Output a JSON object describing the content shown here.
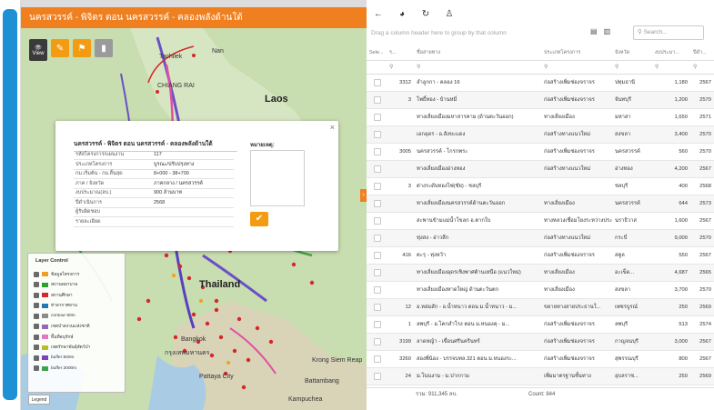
{
  "map": {
    "title": "นครสวรรค์ - พิจิตร ตอน นครสวรรค์ - คลองพลังด้านใต้",
    "tools": {
      "view_label": "View"
    },
    "labels": {
      "laos": "Laos",
      "thailand": "Thailand",
      "tachilek": "Tachilek",
      "nan": "Nan",
      "chiang_rai": "CHIANG RAI",
      "bangkok": "Bangkok",
      "krung_thep": "กรุงเทพมหานคร",
      "siem_reap": "Siem Reap",
      "krong_siem_reap": "Krong Siem Reap",
      "battambang": "Battambang",
      "cambodia": "Kampuchea",
      "pattaya": "Pattaya City"
    },
    "popup": {
      "title": "นครสวรรค์ - พิจิตร ตอน นครสวรรค์ - คลองพลังด้านใต้",
      "rows": [
        {
          "k": "รหัสโครงการ/แผนงาน",
          "v": "117"
        },
        {
          "k": "ประเภทโครงการ",
          "v": "บูรณะ/ปรับปรุงทาง"
        },
        {
          "k": "กม.เริ่มต้น - กม.สิ้นสุด",
          "v": "8+000 - 38+700"
        },
        {
          "k": "ภาค / จังหวัด",
          "v": "ภาคกลาง / นครสวรรค์"
        },
        {
          "k": "งบประมาณ(ลบ.)",
          "v": "900 ล้านบาท"
        },
        {
          "k": "ปีดำเนินการ",
          "v": "2568"
        },
        {
          "k": "ผู้รับผิดชอบ",
          "v": ""
        },
        {
          "k": "รายละเอียด",
          "v": ""
        }
      ],
      "note_label": "หมายเหตุ:",
      "ok_icon": "check-icon"
    },
    "layer_control": {
      "title": "Layer Control",
      "items": [
        {
          "label": "ข้อมูลโครงการ",
          "color": "#f0a020"
        },
        {
          "label": "สถานพยาบาล",
          "color": "#2ca02c"
        },
        {
          "label": "สถานศึกษา",
          "color": "#d62728"
        },
        {
          "label": "ท่าอากาศยาน",
          "color": "#1f77b4"
        },
        {
          "label": "contour 50m",
          "color": "#8c8c8c"
        },
        {
          "label": "เขตป่าสงวนแห่งชาติ",
          "color": "#9467bd"
        },
        {
          "label": "พื้นที่อนุรักษ์",
          "color": "#e377c2"
        },
        {
          "label": "เขตรักษาพันธุ์สัตว์ป่า",
          "color": "#bcbd22"
        },
        {
          "label": "buffer 500m",
          "color": "#7f3fbf"
        },
        {
          "label": "buffer 2000m",
          "color": "#3fa34d"
        }
      ]
    },
    "legend_label": "Legend"
  },
  "grid": {
    "group_hint": "Drag a column header here to group by that column",
    "search_placeholder": "Search...",
    "headers": [
      "Sele...",
      "ร...",
      "ชื่อสายทาง",
      "ประเภทโครงการ",
      "จังหวัด",
      "งบประมา...",
      "ปีดำ..."
    ],
    "filter_icon": "search-icon",
    "rows": [
      {
        "id": "3312",
        "name": "ลำลูกกา - คลอง 16",
        "type": "ก่อสร้างเพิ่มช่องจราจร",
        "prov": "ปทุมธานี",
        "budget": "1,180",
        "year": "2567"
      },
      {
        "id": "3",
        "name": "โพธิ์ทอง - บ้านหมี่",
        "type": "ก่อสร้างเพิ่มช่องจราจร",
        "prov": "จันทบุรี",
        "budget": "1,200",
        "year": "2570"
      },
      {
        "id": "",
        "name": "ทางเลี่ยงเมืองมหาสารคาม (ด้านตะวันออก)",
        "type": "ทางเลี่ยงเมือง",
        "prov": "มหาสา",
        "budget": "1,650",
        "year": "2571"
      },
      {
        "id": "",
        "name": "เอกอุดร - อ.สังขะแดง",
        "type": "ก่อสร้างทางแนวใหม่",
        "prov": "สงขลา",
        "budget": "3,400",
        "year": "2570"
      },
      {
        "id": "3005",
        "name": "นครสวรรค์ - โกรกพระ",
        "type": "ก่อสร้างเพิ่มช่องจราจร",
        "prov": "นครสวรรค์",
        "budget": "560",
        "year": "2570"
      },
      {
        "id": "",
        "name": "ทางเลี่ยงเมืองอ่างทอง",
        "type": "ก่อสร้างทางแนวใหม่",
        "prov": "อ่างทอง",
        "budget": "4,200",
        "year": "2567"
      },
      {
        "id": "3",
        "name": "ต่างระดับทองไฟ(ชัย) - ชลบุรี",
        "type": "",
        "prov": "ชลบุรี",
        "budget": "400",
        "year": "2568"
      },
      {
        "id": "",
        "name": "ทางเลี่ยงเมืองนครสวรรค์ด้านตะวันออก",
        "type": "ทางเลี่ยงเมือง",
        "prov": "นครสวรรค์",
        "budget": "644",
        "year": "2573"
      },
      {
        "id": "",
        "name": "สะพานข้ามแม่น้ำโขลก อ.ตากใบ",
        "type": "ทางหลวงเชื่อมโยงระหว่างประเทศ",
        "prov": "นราธิวาส",
        "budget": "1,600",
        "year": "2567"
      },
      {
        "id": "",
        "name": "ทุ่งสง - อ่าวลึก",
        "type": "ก่อสร้างทางแนวใหม่",
        "prov": "กระบี่",
        "budget": "9,000",
        "year": "2570"
      },
      {
        "id": "416",
        "name": "ตะรุ - ทุ่งหว้า",
        "type": "ก่อสร้างเพิ่มช่องจราจร",
        "prov": "สตูล",
        "budget": "550",
        "year": "2567"
      },
      {
        "id": "",
        "name": "ทางเลี่ยงเมืองอุดรเชิงพาศต้านเหนือ (แนวใหม่)",
        "type": "ทางเลี่ยงเมือง",
        "prov": "อะเข็ด...",
        "budget": "4,687",
        "year": "2565"
      },
      {
        "id": "",
        "name": "ทางเลี่ยงเมืองหาดใหญ่ ด้านตะวันตก",
        "type": "ทางเลี่ยงเมือง",
        "prov": "สงขลา",
        "budget": "3,700",
        "year": "2570"
      },
      {
        "id": "12",
        "name": "อ.หล่มสัก - อ.น้ำหนาว ตอน ม.น้ำหนาว - ม...",
        "type": "ขยายทางสายประธานใ...",
        "prov": "เพชรบูรณ์",
        "budget": "250",
        "year": "2569"
      },
      {
        "id": "1",
        "name": "ลพบุรี - อ.โคกสำโรง ตอน ม.หนองคุ - ม...",
        "type": "ก่อสร้างเพิ่มช่องจราจร",
        "prov": "ลพบุรี",
        "budget": "513",
        "year": "2574"
      },
      {
        "id": "3199",
        "name": "ลาดหญ้า - เขื่อนศรีนครินทร์",
        "type": "ก่อสร้างเพิ่มช่องจราจร",
        "prov": "กาญจนบุรี",
        "budget": "3,000",
        "year": "2567"
      },
      {
        "id": "3260",
        "name": "สองพี่น้อง - บรรจบทล.321 ตอน ม.หนองระ...",
        "type": "ก่อสร้างเพิ่มช่องจราจร",
        "prov": "สุพรรณบุรี",
        "budget": "800",
        "year": "2567"
      },
      {
        "id": "24",
        "name": "ม.โนนงาม - ม.ปากกาม",
        "type": "เพิ่มมาตรฐานชั้นทาง",
        "prov": "อุบลราช...",
        "budget": "250",
        "year": "2569"
      }
    ],
    "footer_sum": "รวม: 911,345 ลบ.",
    "footer_count": "Count: 844"
  }
}
